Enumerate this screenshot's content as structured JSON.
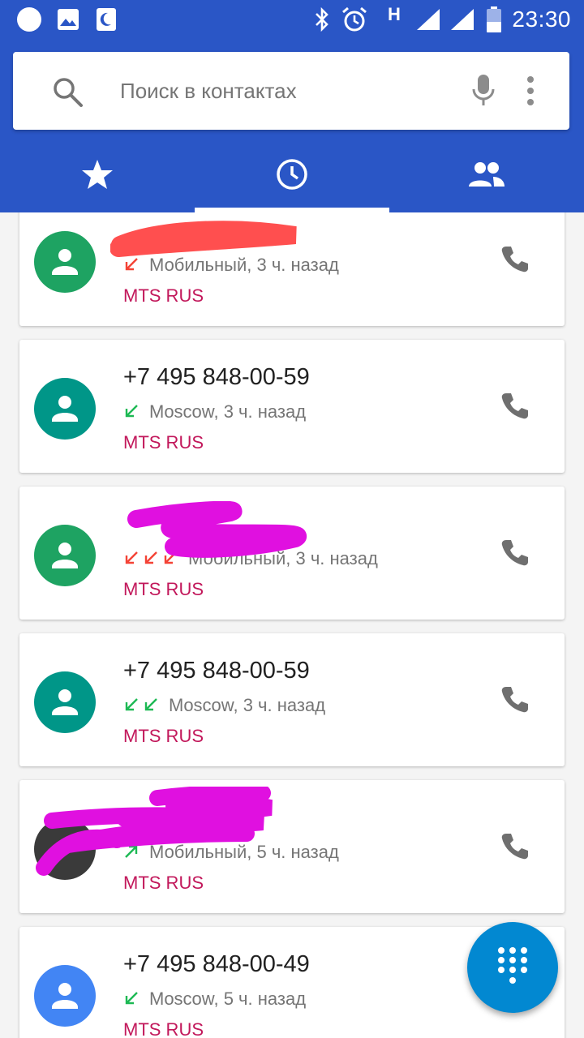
{
  "status_bar": {
    "time": "23:30",
    "network_type": "H",
    "icons": [
      "notification-dot-icon",
      "image-icon",
      "moon-icon",
      "bluetooth-icon",
      "alarm-icon",
      "signal-icon",
      "signal-icon",
      "battery-icon"
    ]
  },
  "search": {
    "placeholder": "Поиск в контактах",
    "icons": [
      "search-icon",
      "mic-icon",
      "more-vert-icon"
    ]
  },
  "tabs": [
    {
      "name": "favorites",
      "icon": "star-icon",
      "selected": false
    },
    {
      "name": "recents",
      "icon": "clock-icon",
      "selected": true
    },
    {
      "name": "contacts",
      "icon": "people-icon",
      "selected": false
    }
  ],
  "calls": [
    {
      "name": "",
      "detail": "Мобильный, 3 ч. назад",
      "sim": "MTS RUS",
      "direction": "missed",
      "count": 1,
      "avatar_color": "#1ea362"
    },
    {
      "name": "+7 495 848-00-59",
      "detail": "Moscow, 3 ч. назад",
      "sim": "MTS RUS",
      "direction": "incoming",
      "count": 1,
      "avatar_color": "#009688"
    },
    {
      "name": "",
      "detail": "Мобильный, 3 ч. назад",
      "sim": "MTS RUS",
      "direction": "missed",
      "count": 3,
      "avatar_color": "#1ea362"
    },
    {
      "name": "+7 495 848-00-59",
      "detail": "Moscow, 3 ч. назад",
      "sim": "MTS RUS",
      "direction": "incoming",
      "count": 2,
      "avatar_color": "#009688"
    },
    {
      "name": "",
      "detail": "Мобильный, 5 ч. назад",
      "sim": "MTS RUS",
      "direction": "outgoing",
      "count": 1,
      "avatar_color": "#3a3a3a"
    },
    {
      "name": "+7 495 848-00-49",
      "detail": "Moscow, 5 ч. назад",
      "sim": "MTS RUS",
      "direction": "incoming",
      "count": 1,
      "avatar_color": "#4285f4"
    }
  ],
  "colors": {
    "primary": "#2a56c6",
    "accent_fab": "#0288d1",
    "sim_label": "#c2185b",
    "missed_arrow": "#f44336",
    "incoming_arrow": "#1db954",
    "redaction_red": "#ff4f4f",
    "redaction_magenta": "#e010e0"
  },
  "fab": {
    "icon": "dialpad-icon"
  }
}
